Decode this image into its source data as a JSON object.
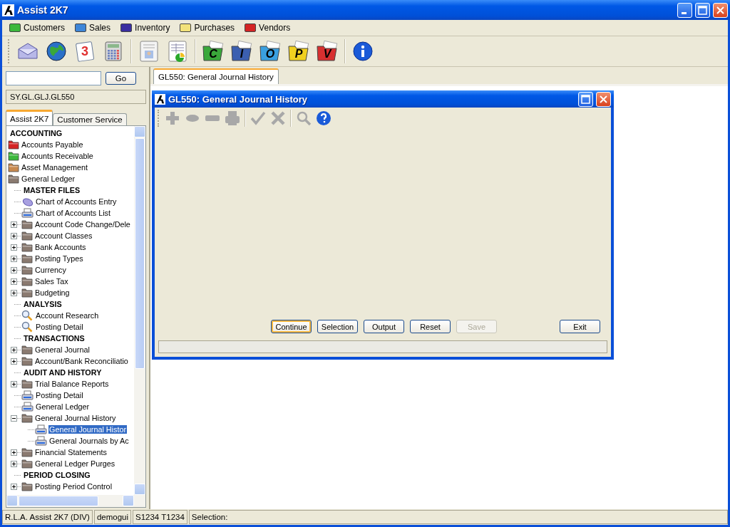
{
  "window": {
    "title": "Assist 2K7"
  },
  "menu": [
    {
      "label": "Customers",
      "color": "#3cb83c"
    },
    {
      "label": "Sales",
      "color": "#3d86d8"
    },
    {
      "label": "Inventory",
      "color": "#3a2fa0"
    },
    {
      "label": "Purchases",
      "color": "#f2e27a"
    },
    {
      "label": "Vendors",
      "color": "#d42424"
    }
  ],
  "toolbar": [
    {
      "kind": "mail"
    },
    {
      "kind": "globe"
    },
    {
      "kind": "calendar",
      "letter": "3"
    },
    {
      "kind": "calculator"
    },
    {
      "kind": "separator"
    },
    {
      "kind": "contact-form"
    },
    {
      "kind": "sheet-chart"
    },
    {
      "kind": "separator"
    },
    {
      "kind": "letter-folder",
      "letter": "C",
      "color": "#3aa83a"
    },
    {
      "kind": "letter-folder",
      "letter": "I",
      "color": "#3b5fb0"
    },
    {
      "kind": "letter-folder",
      "letter": "O",
      "color": "#3aa0e0"
    },
    {
      "kind": "letter-folder",
      "letter": "P",
      "color": "#f0d020"
    },
    {
      "kind": "letter-folder",
      "letter": "V",
      "color": "#d83030"
    },
    {
      "kind": "separator"
    },
    {
      "kind": "info"
    }
  ],
  "left": {
    "go_button": "Go",
    "path": "SY.GL.GLJ.GL550",
    "tabs": [
      {
        "label": "Assist 2K7",
        "selected": true
      },
      {
        "label": "Customer Service",
        "selected": false
      }
    ],
    "tree": [
      {
        "kind": "section",
        "label": "ACCOUNTING"
      },
      {
        "kind": "folder",
        "label": "Accounts Payable",
        "color": "#d42424"
      },
      {
        "kind": "folder",
        "label": "Accounts Receivable",
        "color": "#3cb83c"
      },
      {
        "kind": "folder",
        "label": "Asset Management",
        "color": "#c88a50"
      },
      {
        "kind": "folder",
        "label": "General Ledger",
        "color": "#8a7a70",
        "children": [
          {
            "kind": "section",
            "label": "MASTER FILES"
          },
          {
            "kind": "form",
            "label": "Chart of Accounts Entry"
          },
          {
            "kind": "printer",
            "label": "Chart of Accounts List"
          },
          {
            "kind": "folder",
            "label": "Account Code Change/Dele",
            "color": "#8a7a70",
            "expanded": false
          },
          {
            "kind": "folder",
            "label": "Account Classes",
            "color": "#8a7a70",
            "expanded": false
          },
          {
            "kind": "folder",
            "label": "Bank Accounts",
            "color": "#8a7a70",
            "expanded": false
          },
          {
            "kind": "folder",
            "label": "Posting Types",
            "color": "#8a7a70",
            "expanded": false
          },
          {
            "kind": "folder",
            "label": "Currency",
            "color": "#8a7a70",
            "expanded": false
          },
          {
            "kind": "folder",
            "label": "Sales Tax",
            "color": "#8a7a70",
            "expanded": false
          },
          {
            "kind": "folder",
            "label": "Budgeting",
            "color": "#8a7a70",
            "expanded": false
          },
          {
            "kind": "section",
            "label": "ANALYSIS"
          },
          {
            "kind": "search",
            "label": "Account Research"
          },
          {
            "kind": "search",
            "label": "Posting Detail"
          },
          {
            "kind": "section",
            "label": "TRANSACTIONS"
          },
          {
            "kind": "folder",
            "label": "General Journal",
            "color": "#8a7a70",
            "expanded": false
          },
          {
            "kind": "folder",
            "label": "Account/Bank Reconciliatio",
            "color": "#8a7a70",
            "expanded": false
          },
          {
            "kind": "section",
            "label": "AUDIT AND HISTORY"
          },
          {
            "kind": "folder",
            "label": "Trial Balance Reports",
            "color": "#8a7a70",
            "expanded": false
          },
          {
            "kind": "printer",
            "label": "Posting Detail"
          },
          {
            "kind": "printer",
            "label": "General Ledger"
          },
          {
            "kind": "folder",
            "label": "General Journal History",
            "color": "#8a7a70",
            "expanded": true,
            "children": [
              {
                "kind": "printer",
                "label": "General Journal Histor",
                "selected": true
              },
              {
                "kind": "printer",
                "label": "General Journals by Ac",
                "selected": false
              }
            ]
          },
          {
            "kind": "folder",
            "label": "Financial Statements",
            "color": "#8a7a70",
            "expanded": false
          },
          {
            "kind": "folder",
            "label": "General Ledger Purges",
            "color": "#8a7a70",
            "expanded": false
          },
          {
            "kind": "section",
            "label": "PERIOD CLOSING"
          },
          {
            "kind": "folder",
            "label": "Posting Period Control",
            "color": "#8a7a70",
            "expanded": false
          }
        ]
      }
    ]
  },
  "doc_tabs": [
    {
      "label": "GL550: General Journal History",
      "selected": true
    }
  ],
  "dialog": {
    "title": "GL550: General Journal History",
    "toolbar": [
      {
        "kind": "add",
        "disabled": true
      },
      {
        "kind": "eraser",
        "disabled": true
      },
      {
        "kind": "minus",
        "disabled": true
      },
      {
        "kind": "printer",
        "disabled": true
      },
      {
        "kind": "separator"
      },
      {
        "kind": "check",
        "disabled": true
      },
      {
        "kind": "cross",
        "disabled": true
      },
      {
        "kind": "separator"
      },
      {
        "kind": "search",
        "disabled": true
      },
      {
        "kind": "help",
        "disabled": false
      }
    ],
    "buttons": [
      {
        "label": "Continue",
        "focused": true,
        "disabled": false
      },
      {
        "label": "Selection",
        "focused": false,
        "disabled": false
      },
      {
        "label": "Output",
        "focused": false,
        "disabled": false
      },
      {
        "label": "Reset",
        "focused": false,
        "disabled": false
      },
      {
        "label": "Save",
        "focused": false,
        "disabled": true
      },
      {
        "label": "Exit",
        "focused": false,
        "disabled": false,
        "kind": "apart"
      }
    ]
  },
  "status_bar": [
    "R.L.A. Assist 2K7 (DIV)",
    "demogui",
    "S1234 T1234",
    "Selection:"
  ]
}
